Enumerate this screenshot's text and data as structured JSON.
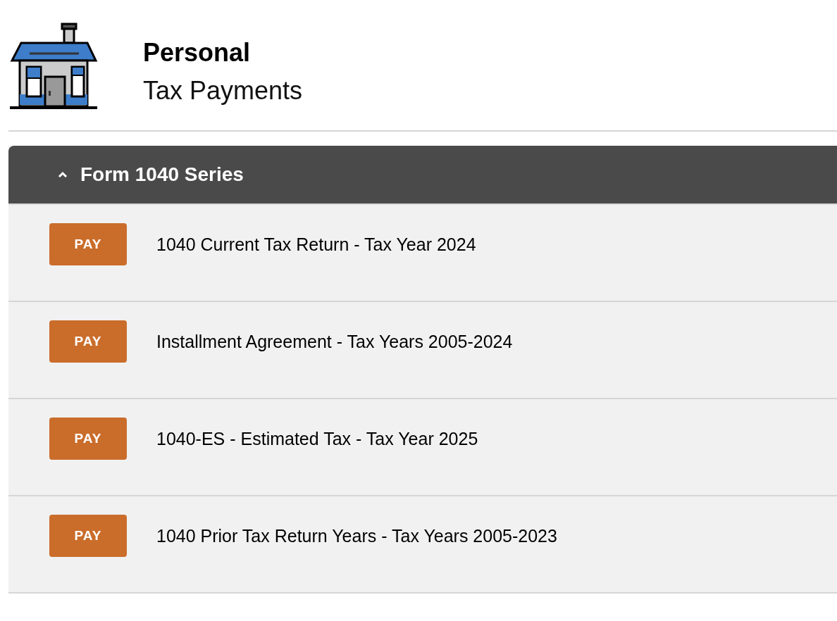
{
  "header": {
    "title": "Personal",
    "subtitle": "Tax Payments"
  },
  "section": {
    "title": "Form 1040 Series",
    "expanded": true,
    "items": [
      {
        "button": "PAY",
        "label": "1040 Current Tax Return - Tax Year 2024"
      },
      {
        "button": "PAY",
        "label": "Installment Agreement - Tax Years 2005-2024"
      },
      {
        "button": "PAY",
        "label": "1040-ES - Estimated Tax - Tax Year 2025"
      },
      {
        "button": "PAY",
        "label": "1040 Prior Tax Return Years - Tax Years 2005-2023"
      }
    ]
  }
}
